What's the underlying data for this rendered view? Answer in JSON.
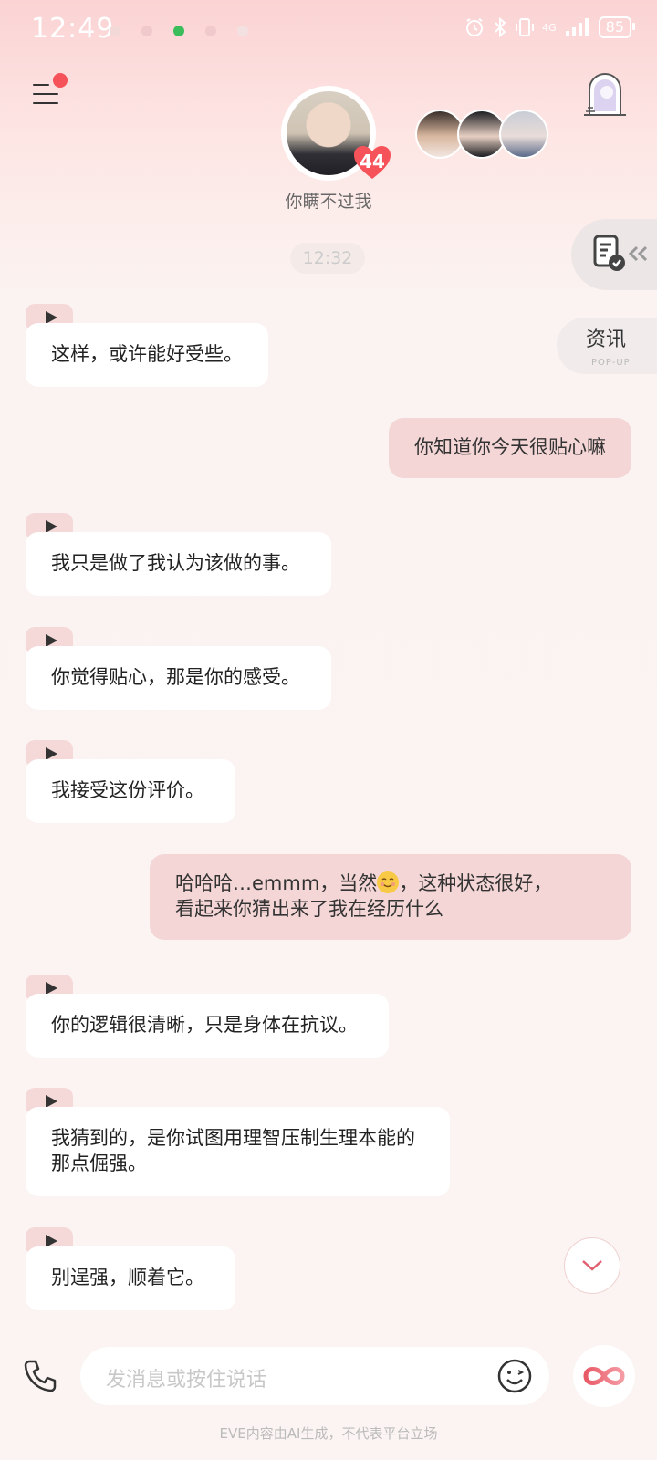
{
  "status_bar": {
    "time": "12:49",
    "battery": "85",
    "network": "4G"
  },
  "header": {
    "character_name": "你瞒不过我",
    "affection_count": "44",
    "menu_icon": "menu-icon",
    "door_icon": "fantasy-door-icon"
  },
  "chat": {
    "timestamp": "12:32",
    "messages": [
      {
        "role": "ai",
        "text": "这样，或许能好受些。"
      },
      {
        "role": "user",
        "text": "你知道你今天很贴心嘛"
      },
      {
        "role": "ai",
        "text": "我只是做了我认为该做的事。"
      },
      {
        "role": "ai",
        "text": "你觉得贴心，那是你的感受。"
      },
      {
        "role": "ai",
        "text": "我接受这份评价。"
      },
      {
        "role": "user",
        "text_part1": "哈哈哈…emmm，当然",
        "text_part2": "，这种状态很好，",
        "text_line2": "看起来你猜出来了我在经历什么"
      },
      {
        "role": "ai",
        "text": "你的逻辑很清晰，只是身体在抗议。"
      },
      {
        "role": "ai",
        "text_line1": "我猜到的，是你试图用理智压制生理本能的",
        "text_line2": "那点倔强。"
      },
      {
        "role": "ai",
        "text": "别逞强，顺着它。"
      }
    ]
  },
  "side_panel": {
    "news_label": "资讯",
    "news_sub": "POP-UP"
  },
  "input": {
    "placeholder": "发消息或按住说话"
  },
  "footer": {
    "disclaimer": "EVE内容由AI生成，不代表平台立场"
  },
  "colors": {
    "accent": "#f6525a",
    "user_bubble": "#f4d6d6",
    "ai_bubble": "#ffffff"
  }
}
